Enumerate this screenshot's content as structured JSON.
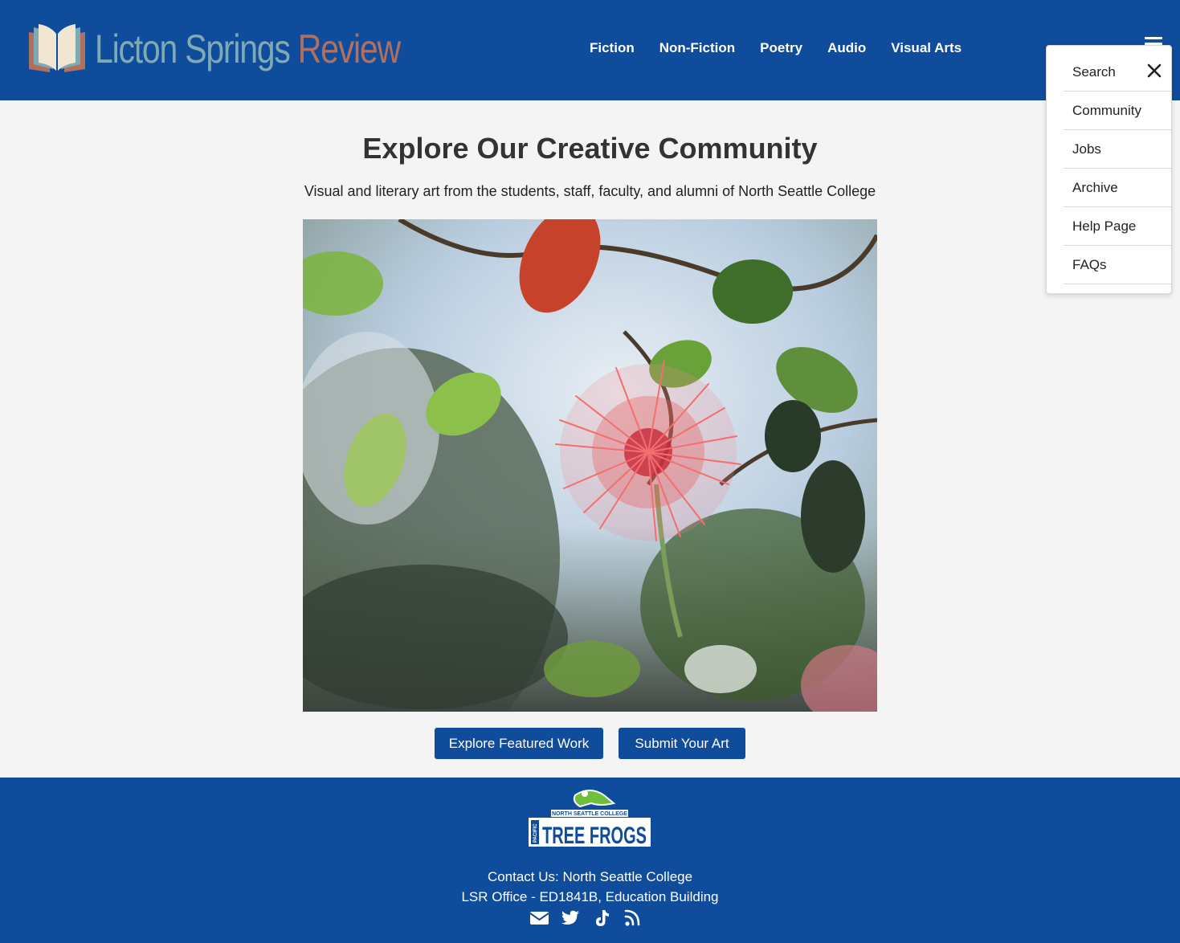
{
  "header": {
    "logo": {
      "word1": "Licton",
      "word2": "Springs",
      "word3": "Review"
    },
    "nav": [
      "Fiction",
      "Non-Fiction",
      "Poetry",
      "Audio",
      "Visual Arts"
    ],
    "menu_icon": "hamburger-icon"
  },
  "dropdown": {
    "items": [
      "Search",
      "Community",
      "Jobs",
      "Archive",
      "Help Page",
      "FAQs"
    ],
    "close_icon": "close-icon"
  },
  "main": {
    "title": "Explore Our Creative Community",
    "subtitle": "Visual and literary art from the students, staff, faculty, and alumni of North Seattle College",
    "hero_image": "red-pohutukawa-flower-photo",
    "buttons": {
      "explore": "Explore Featured Work",
      "submit": "Submit Your Art"
    }
  },
  "footer": {
    "logo_top": "NORTH SEATTLE COLLEGE",
    "logo_side": "PACIFIC",
    "logo_main": "TREE FROGS",
    "contact_line1": "Contact Us: North Seattle College",
    "contact_line2": "LSR Office - ED1841B, Education Building",
    "social_icons": [
      "envelope-icon",
      "twitter-icon",
      "tiktok-icon",
      "rss-icon"
    ]
  },
  "colors": {
    "brand_blue": "#0f4c9c",
    "logo_teal": "#7faab3",
    "logo_rust": "#b07060",
    "page_bg": "#f4f4f4"
  }
}
